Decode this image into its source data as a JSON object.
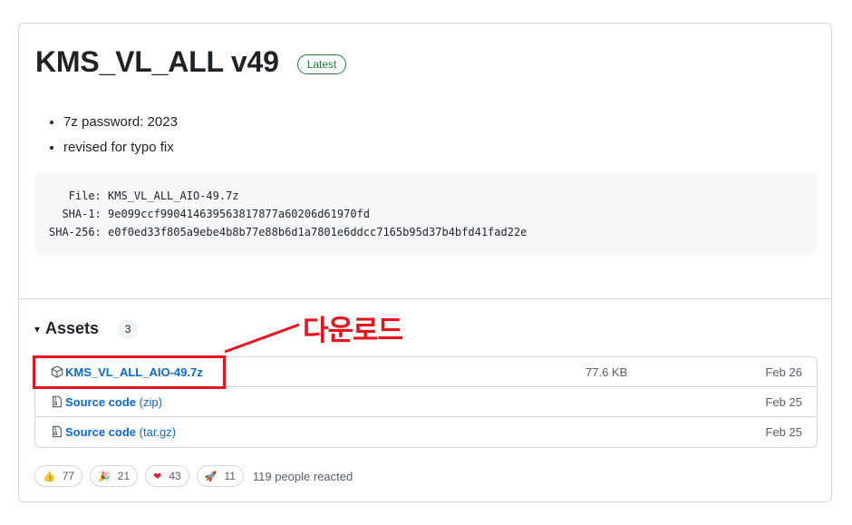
{
  "release": {
    "title": "KMS_VL_ALL v49",
    "badge": "Latest",
    "notes": [
      "7z password: 2023",
      "revised for typo fix"
    ],
    "hashes": "   File: KMS_VL_ALL_AIO-49.7z\n  SHA-1: 9e099ccf990414639563817877a60206d61970fd\nSHA-256: e0f0ed33f805a9ebe4b8b77e88b6d1a7801e6ddcc7165b95d37b4bfd41fad22e"
  },
  "assets": {
    "caret": "▾",
    "title": "Assets",
    "count": "3",
    "items": [
      {
        "name": "KMS_VL_ALL_AIO-49.7z",
        "suffix": "",
        "size": "77.6 KB",
        "date": "Feb 26",
        "icon": "package-icon"
      },
      {
        "name": "Source code",
        "suffix": " (zip)",
        "size": "",
        "date": "Feb 25",
        "icon": "file-zip-icon"
      },
      {
        "name": "Source code",
        "suffix": " (tar.gz)",
        "size": "",
        "date": "Feb 25",
        "icon": "file-zip-icon"
      }
    ]
  },
  "annotation": {
    "text": "다운로드",
    "color": "#e6141c"
  },
  "reactions": {
    "items": [
      {
        "emoji": "👍",
        "count": "77",
        "icon": "thumbs-up-icon"
      },
      {
        "emoji": "🎉",
        "count": "21",
        "icon": "tada-icon"
      },
      {
        "emoji": "❤",
        "count": "43",
        "icon": "heart-icon"
      },
      {
        "emoji": "🚀",
        "count": "11",
        "icon": "rocket-icon"
      }
    ],
    "summary": "119 people reacted"
  },
  "colors": {
    "link": "#0969da",
    "badge_green": "#1a7f37",
    "annotation_red": "#e6141c"
  }
}
